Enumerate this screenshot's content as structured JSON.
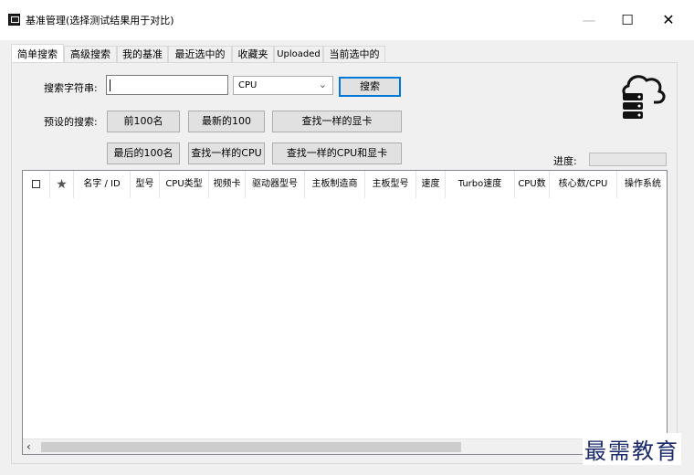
{
  "window": {
    "title": "基准管理(选择测试结果用于对比)",
    "minimize": "—",
    "maximize": "☐",
    "close": "✕"
  },
  "tabs": [
    {
      "label": "简单搜索",
      "active": true
    },
    {
      "label": "高级搜索",
      "active": false
    },
    {
      "label": "我的基准",
      "active": false
    },
    {
      "label": "最近选中的",
      "active": false
    },
    {
      "label": "收藏夹",
      "active": false
    },
    {
      "label": "Uploaded",
      "active": false
    },
    {
      "label": "当前选中的",
      "active": false
    }
  ],
  "search": {
    "label": "搜索字符串:",
    "value": "",
    "type_value": "CPU",
    "search_button": "搜索"
  },
  "presets": {
    "label": "预设的搜索:",
    "top100": "前100名",
    "latest100": "最新的100",
    "same_gpu": "查找一样的显卡",
    "last100": "最后的100名",
    "same_cpu": "查找一样的CPU",
    "same_cpu_gpu": "查找一样的CPU和显卡"
  },
  "progress": {
    "label": "进度:",
    "value": 0
  },
  "table": {
    "columns": [
      "名字 / ID",
      "型号",
      "CPU类型",
      "视频卡",
      "驱动器型号",
      "主板制造商",
      "主板型号",
      "速度",
      "Turbo速度",
      "CPU数",
      "核心数/CPU",
      "操作系统"
    ],
    "rows": []
  },
  "watermark": "最需教育",
  "icons": {
    "app": "app-window-icon",
    "cloud": "cloud-database-icon",
    "star": "favorite-star-icon",
    "checkbox": "checkbox-icon",
    "scroll_left": "chevron-left-icon",
    "select_chevron": "chevron-down-icon"
  },
  "colors": {
    "focus_border": "#0078d7",
    "window_bg": "#f0f0f0",
    "watermark": "#1b2b6b"
  }
}
